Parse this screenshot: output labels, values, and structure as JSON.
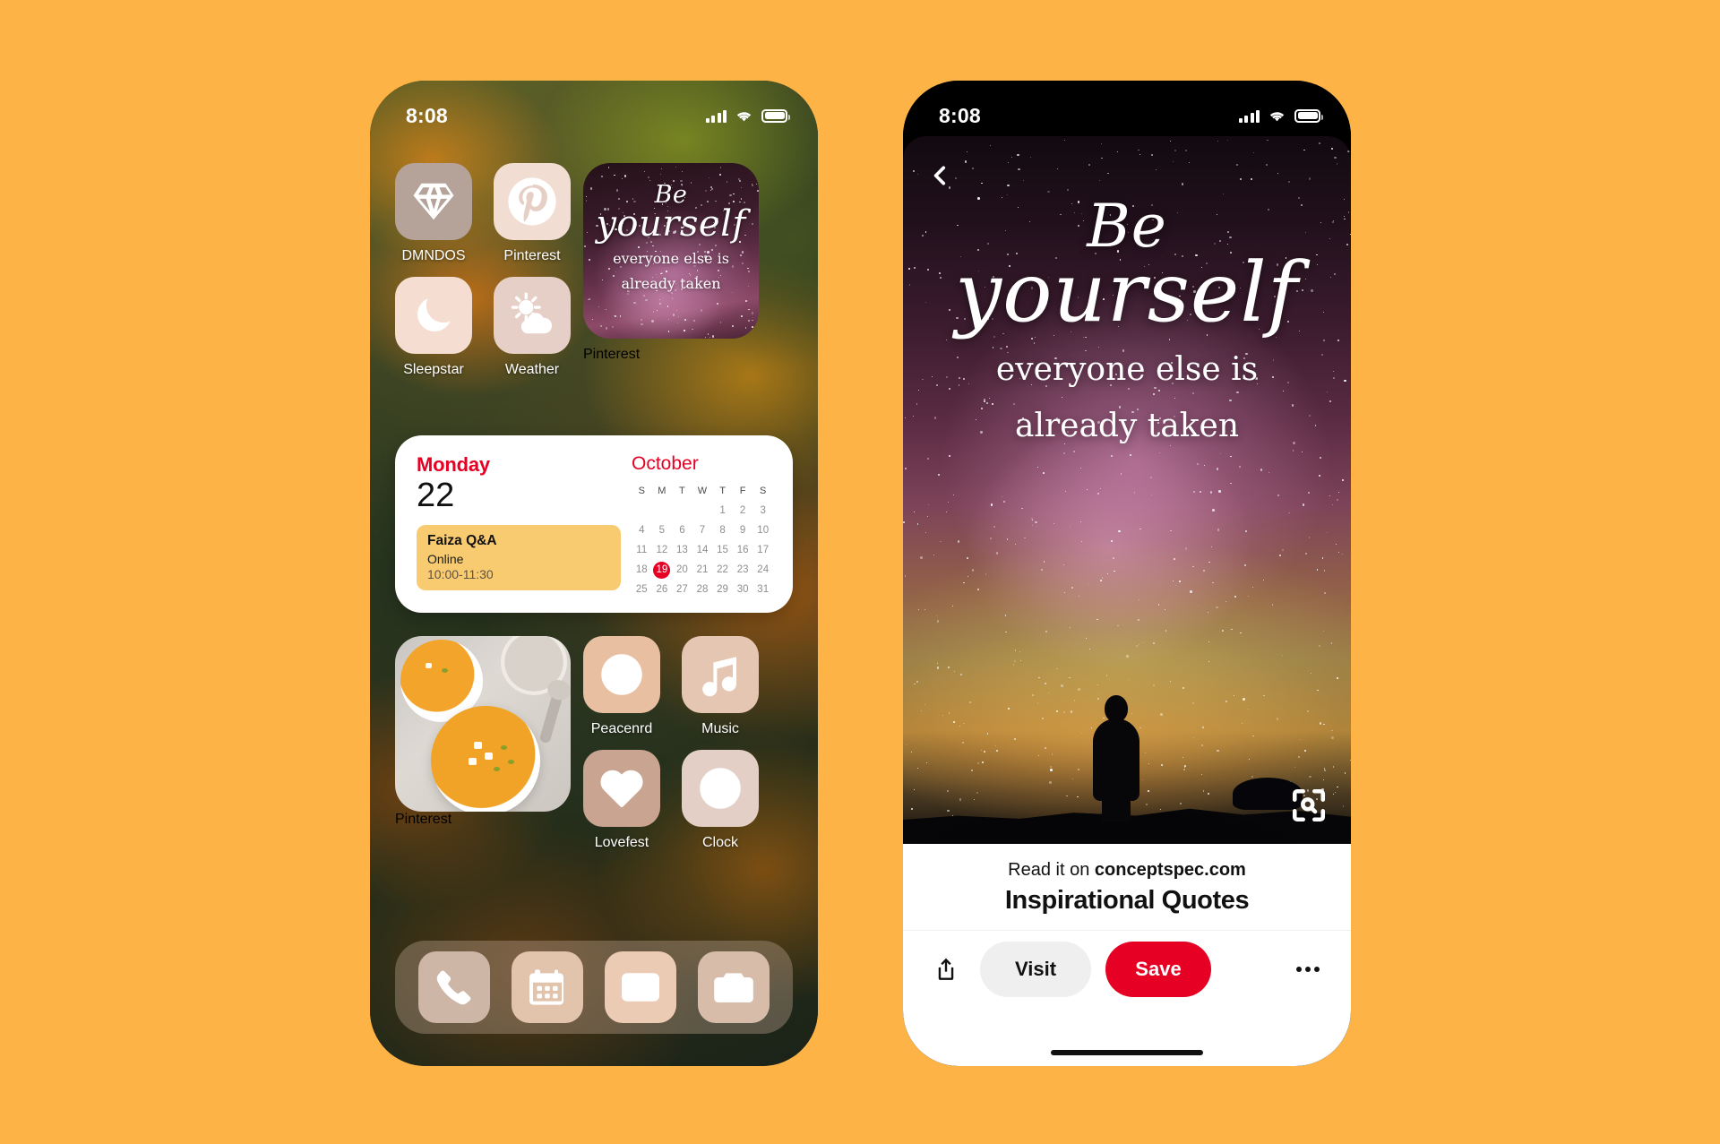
{
  "page": {
    "background_color": "#FDB346",
    "brand_red": "#E60023",
    "event_yellow": "#F9CB71"
  },
  "left_phone": {
    "status_bar": {
      "time": "8:08",
      "signal_icon": "cellular-bars-icon",
      "wifi_icon": "wifi-icon",
      "battery_icon": "battery-icon"
    },
    "apps_top": [
      {
        "label": "DMNDOS",
        "icon": "diamond-icon",
        "tile_color": "#b5a299"
      },
      {
        "label": "Pinterest",
        "icon": "pinterest-icon",
        "tile_color": "#f2ddd2"
      },
      {
        "label": "Sleepstar",
        "icon": "moon-icon",
        "tile_color": "#f5ded1"
      },
      {
        "label": "Weather",
        "icon": "sun-cloud-icon",
        "tile_color": "#e6cfc6"
      }
    ],
    "quote_widget": {
      "label": "Pinterest",
      "line1": "Be",
      "line2": "yourself",
      "line3": "everyone else is",
      "line4": "already taken"
    },
    "calendar_widget": {
      "day_name": "Monday",
      "day_number": "22",
      "month": "October",
      "weekday_headers": [
        "S",
        "M",
        "T",
        "W",
        "T",
        "F",
        "S"
      ],
      "leading_blanks": 4,
      "days": [
        1,
        2,
        3,
        4,
        5,
        6,
        7,
        8,
        9,
        10,
        11,
        12,
        13,
        14,
        15,
        16,
        17,
        18,
        19,
        20,
        21,
        22,
        23,
        24,
        25,
        26,
        27,
        28,
        29,
        30,
        31
      ],
      "today": 19,
      "event": {
        "title": "Faiza Q&A",
        "location": "Online",
        "time": "10:00-11:30"
      }
    },
    "photo_widget": {
      "label": "Pinterest",
      "icon": "soup-photo"
    },
    "apps_bottom": [
      {
        "label": "Peacenrd",
        "icon": "peace-icon",
        "tile_color": "#e9bfa2"
      },
      {
        "label": "Music",
        "icon": "music-note-icon",
        "tile_color": "#e5c6b2"
      },
      {
        "label": "Lovefest",
        "icon": "heart-icon",
        "tile_color": "#c9a490"
      },
      {
        "label": "Clock",
        "icon": "clock-icon",
        "tile_color": "#e4cfc6"
      }
    ],
    "dock": [
      {
        "label": "Phone",
        "icon": "phone-icon",
        "tile_color": "#cdb6a6"
      },
      {
        "label": "Calendar",
        "icon": "calendar-icon",
        "tile_color": "#e2c3ab"
      },
      {
        "label": "Mail",
        "icon": "mail-icon",
        "tile_color": "#eccbb4"
      },
      {
        "label": "Camera",
        "icon": "camera-icon",
        "tile_color": "#d7bda9"
      }
    ]
  },
  "right_phone": {
    "status_bar": {
      "time": "8:08",
      "signal_icon": "cellular-bars-icon",
      "wifi_icon": "wifi-icon",
      "battery_icon": "battery-icon"
    },
    "back_icon": "chevron-left-icon",
    "pin_image": {
      "line1": "Be",
      "line2": "yourself",
      "line3": "everyone else is",
      "line4": "already taken",
      "lens_icon": "visual-search-icon"
    },
    "read_it_prefix": "Read it on ",
    "read_it_domain": "conceptspec.com",
    "title": "Inspirational Quotes",
    "actions": {
      "share_icon": "share-icon",
      "visit_label": "Visit",
      "save_label": "Save",
      "more_icon": "overflow-menu-icon"
    }
  }
}
